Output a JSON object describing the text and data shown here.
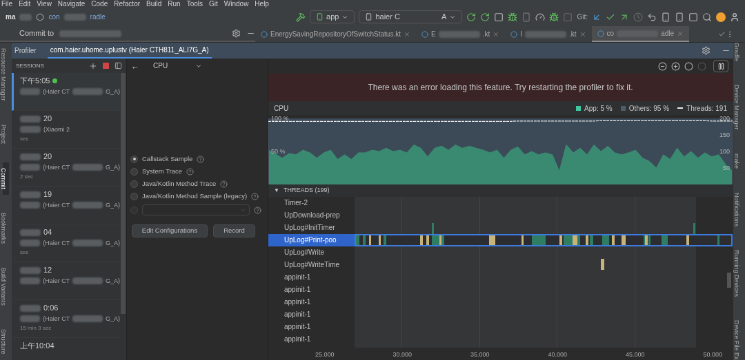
{
  "menu": [
    "File",
    "Edit",
    "View",
    "Navigate",
    "Code",
    "Refactor",
    "Build",
    "Run",
    "Tools",
    "Git",
    "Window",
    "Help"
  ],
  "toolbar": {
    "breadcrumb": [
      "ma",
      "con",
      "radle"
    ],
    "run_config": "app",
    "device_start": "haier C",
    "device_end": "A",
    "vcs_label": "Git:"
  },
  "tool_window": {
    "title": "Commit to"
  },
  "editor_tabs": [
    {
      "start": "EnergySavingRepositoryOfSwitchStatus.kt",
      "selected": false
    },
    {
      "start": "E",
      "end": ".kt",
      "selected": false
    },
    {
      "start": "I",
      "end": ".kt",
      "selected": false
    },
    {
      "start": "co",
      "end": "adle",
      "selected": true
    }
  ],
  "left_strip": [
    {
      "label": "Resource Manager",
      "selected": false
    },
    {
      "label": "Project",
      "selected": false
    },
    {
      "label": "Commit",
      "selected": true
    },
    {
      "label": "Bookmarks",
      "selected": false
    },
    {
      "label": "Build Variants",
      "selected": false
    },
    {
      "label": "Structure",
      "selected": false
    }
  ],
  "right_strip": [
    "Gradle",
    "Device Manager",
    "make",
    "Notifications",
    "Running Devices",
    "Device File Ex"
  ],
  "profiler": {
    "label": "Profiler",
    "tabs": [
      {
        "label": "com.haier.uhome.uplustv (Haier CTH811_ALI7G_A)",
        "selected": true
      }
    ]
  },
  "sessions": {
    "title": "SESSIONS",
    "items": [
      {
        "time": "下午5:05",
        "live": true,
        "device_start": "(Haier CT",
        "device_end": "G_A)",
        "selected": true
      },
      {
        "time": "20",
        "live": false,
        "device_start": "(Xiaomi 2",
        "duration": "sec",
        "selected": false
      },
      {
        "time": "20",
        "live": false,
        "device_start": "(Haier CT",
        "device_end": "G_A)",
        "duration": "2 sec",
        "selected": false
      },
      {
        "time": "19",
        "live": false,
        "device_start": "(Haier CT",
        "device_end": "G_A)",
        "selected": false
      },
      {
        "time": "04",
        "live": false,
        "device_start": "(Haier CT",
        "device_end": "G_A)",
        "duration": "sec",
        "selected": false
      },
      {
        "time": "12",
        "live": false,
        "device_start": "(Haier CT",
        "device_end": "G_A)",
        "selected": false
      },
      {
        "time": "0:06",
        "live": false,
        "device_start": "(Haier CT",
        "device_end": "G_A)",
        "duration": "15 min 3 sec",
        "selected": false
      },
      {
        "time": "上午10:04",
        "live": false,
        "selected": false
      }
    ]
  },
  "cpu_config": {
    "back": "←",
    "monitor": "CPU",
    "options": [
      {
        "label": "Callstack Sample",
        "selected": true
      },
      {
        "label": "System Trace",
        "selected": false
      },
      {
        "label": "Java/Kotlin Method Trace",
        "selected": false
      },
      {
        "label": "Java/Kotlin Method Sample (legacy)",
        "selected": false
      }
    ],
    "custom_selected": false,
    "buttons": [
      "Edit Configurations",
      "Record"
    ]
  },
  "banner": "There was an error loading this feature. Try restarting the profiler to fix it.",
  "cpu": {
    "title": "CPU",
    "legend": [
      {
        "label": "App: 5 %",
        "kind": "square",
        "color": "#3fc7a0"
      },
      {
        "label": "Others: 95 %",
        "kind": "square",
        "color": "#4c5e6e"
      },
      {
        "label": "Threads: 191",
        "kind": "dash",
        "color": "#e8e8e8"
      }
    ],
    "chart_data": {
      "type": "area",
      "ylim": [
        0,
        100
      ],
      "yticks": [
        {
          "value": 50,
          "label": "50 %"
        },
        {
          "value": 100,
          "label": "100 %"
        }
      ],
      "y2lim": [
        0,
        200
      ],
      "y2ticks": [
        50,
        100,
        150,
        200
      ],
      "series": [
        {
          "color": "#3a8a72",
          "values": [
            52,
            46,
            40,
            47,
            45,
            52,
            48,
            40,
            48,
            52,
            38,
            45,
            38,
            48,
            48,
            52,
            50,
            55,
            50,
            52,
            48,
            60,
            55,
            42,
            55,
            58,
            52,
            60,
            55,
            58,
            55,
            52,
            48,
            52,
            40,
            52,
            57,
            45,
            50,
            45,
            48,
            45,
            20,
            60,
            48,
            55,
            45,
            60,
            50,
            58,
            48,
            45,
            48,
            52,
            40,
            35,
            25,
            45,
            38,
            55,
            42,
            50,
            40,
            48,
            42,
            45,
            30,
            20
          ]
        },
        {
          "color": "#e8e8e8",
          "type": "line",
          "line_style": "dashed",
          "axis": "y2",
          "values": [
            191,
            191,
            191,
            191,
            191,
            191,
            191,
            191,
            191,
            191,
            191,
            191,
            191,
            191,
            191,
            191,
            191,
            191,
            191,
            191,
            191,
            191,
            191,
            191,
            191,
            191,
            191,
            191,
            191,
            191,
            191,
            191,
            191,
            191,
            191,
            191,
            192,
            192,
            192,
            192,
            192,
            192,
            192,
            192,
            192,
            192,
            192,
            192,
            193,
            193,
            193,
            193,
            193,
            193,
            193,
            193,
            193,
            193,
            193,
            193,
            193,
            193,
            193,
            193,
            192,
            192,
            192,
            192
          ]
        }
      ]
    }
  },
  "threads": {
    "toggle": "▼",
    "title": "THREADS (199)",
    "items": [
      {
        "name": "Timer-2",
        "selected": false
      },
      {
        "name": "UpDownload-prep",
        "selected": false
      },
      {
        "name": "UpLog#InitTimer",
        "selected": false
      },
      {
        "name": "UpLog#Print-poo",
        "selected": true
      },
      {
        "name": "UpLog#Write",
        "selected": false
      },
      {
        "name": "UpLog#WriteTime",
        "selected": false
      },
      {
        "name": "appinit-1",
        "selected": false
      },
      {
        "name": "appinit-1",
        "selected": false
      },
      {
        "name": "appinit-1",
        "selected": false
      },
      {
        "name": "appinit-1",
        "selected": false
      },
      {
        "name": "appinit-1",
        "selected": false
      },
      {
        "name": "appinit-1",
        "selected": false
      }
    ]
  },
  "time_axis": [
    "25.000",
    "30.000",
    "35.000",
    "40.000",
    "45.000",
    "50.000"
  ]
}
